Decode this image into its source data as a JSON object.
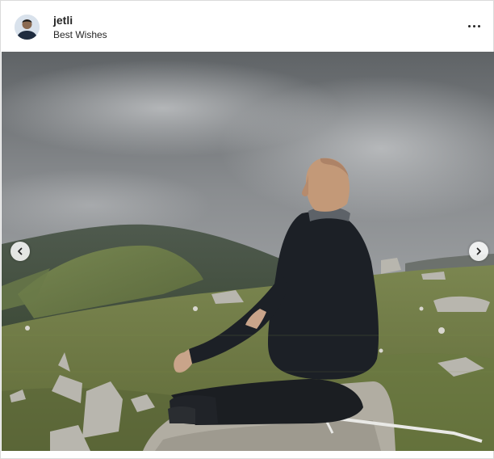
{
  "post": {
    "username": "jetli",
    "location": "Best Wishes"
  },
  "icons": {
    "more": "more-options-icon",
    "prev": "chevron-left-icon",
    "next": "chevron-right-icon"
  },
  "colors": {
    "text": "#262626",
    "border": "#dbdbdb",
    "sky": "#7d8083",
    "grass": "#6d7a3f"
  }
}
